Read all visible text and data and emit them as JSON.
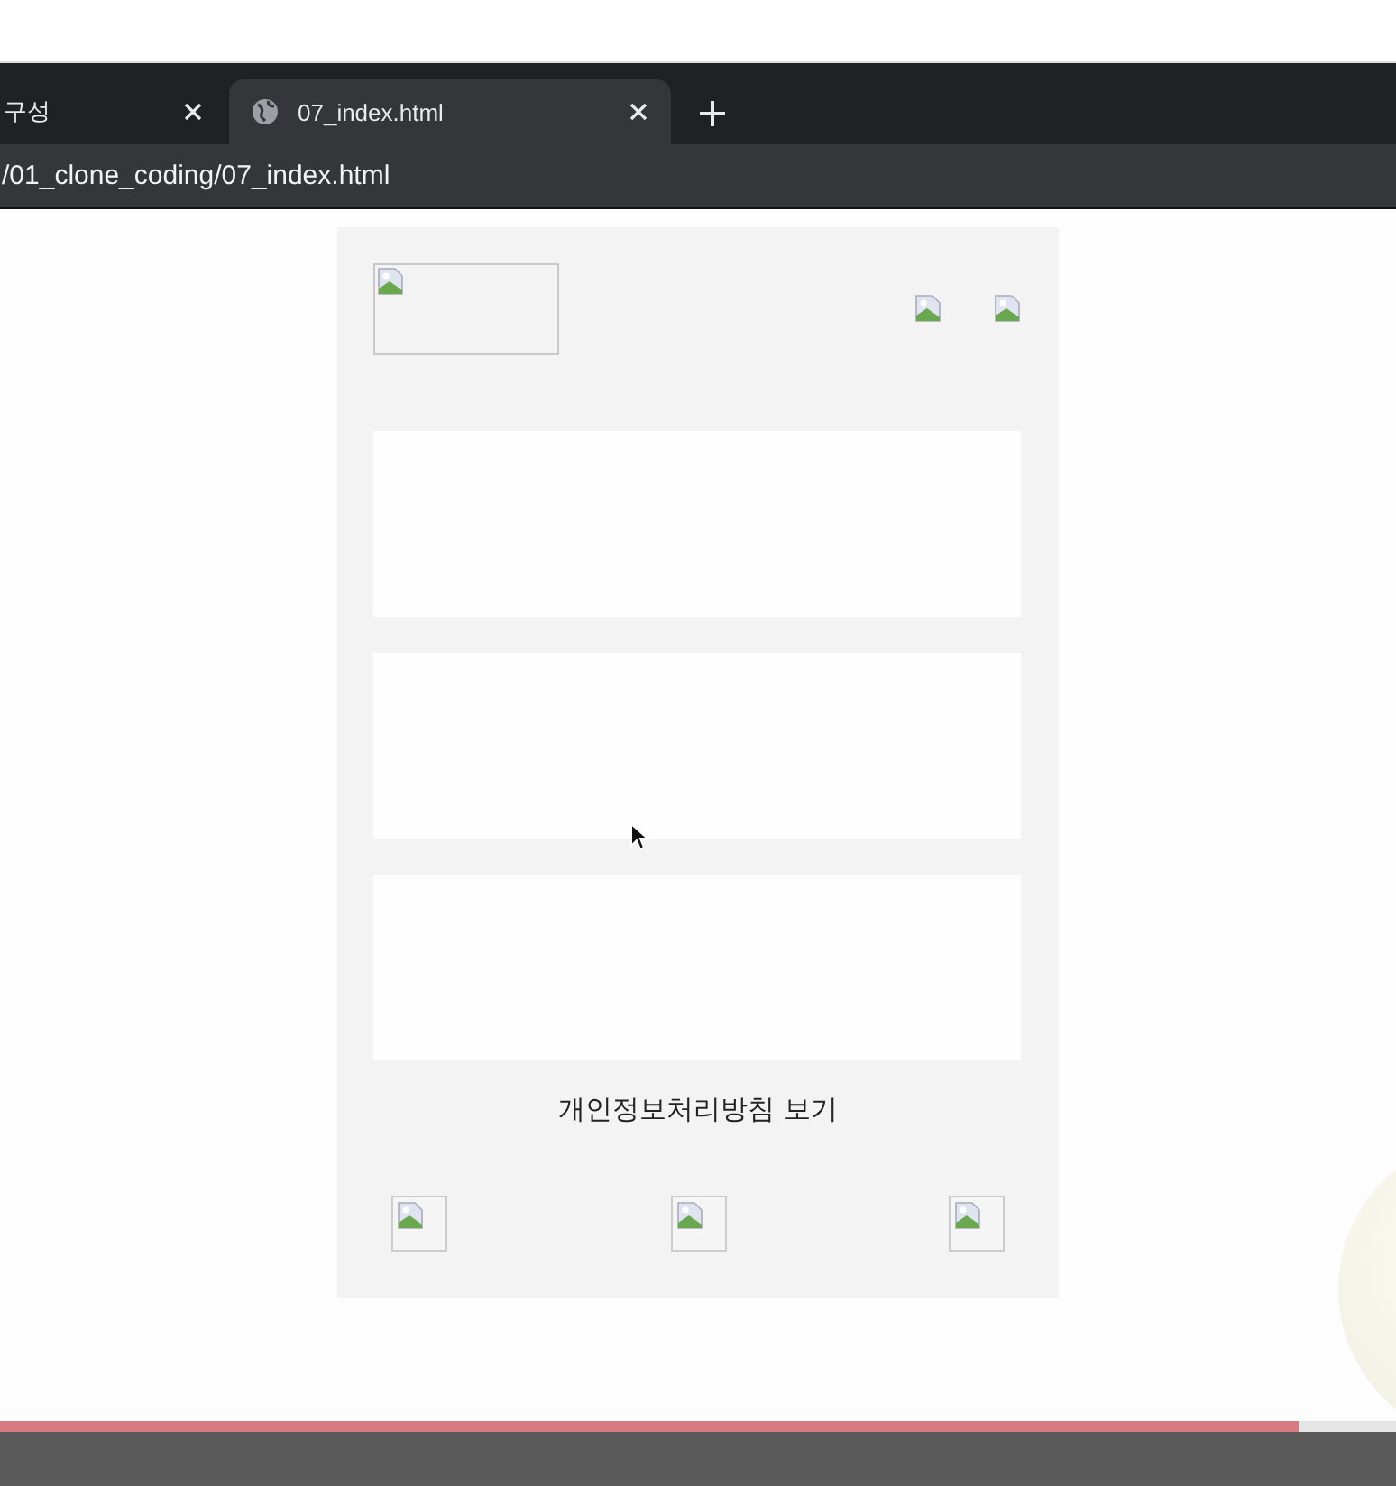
{
  "browser": {
    "tabs": [
      {
        "title": "구성",
        "selected": false
      },
      {
        "title": "07_index.html",
        "selected": true
      }
    ],
    "address": "/01_clone_coding/07_index.html"
  },
  "page": {
    "privacy_link": "개인정보처리방침 보기"
  },
  "video_progress": {
    "level": 0.93
  }
}
